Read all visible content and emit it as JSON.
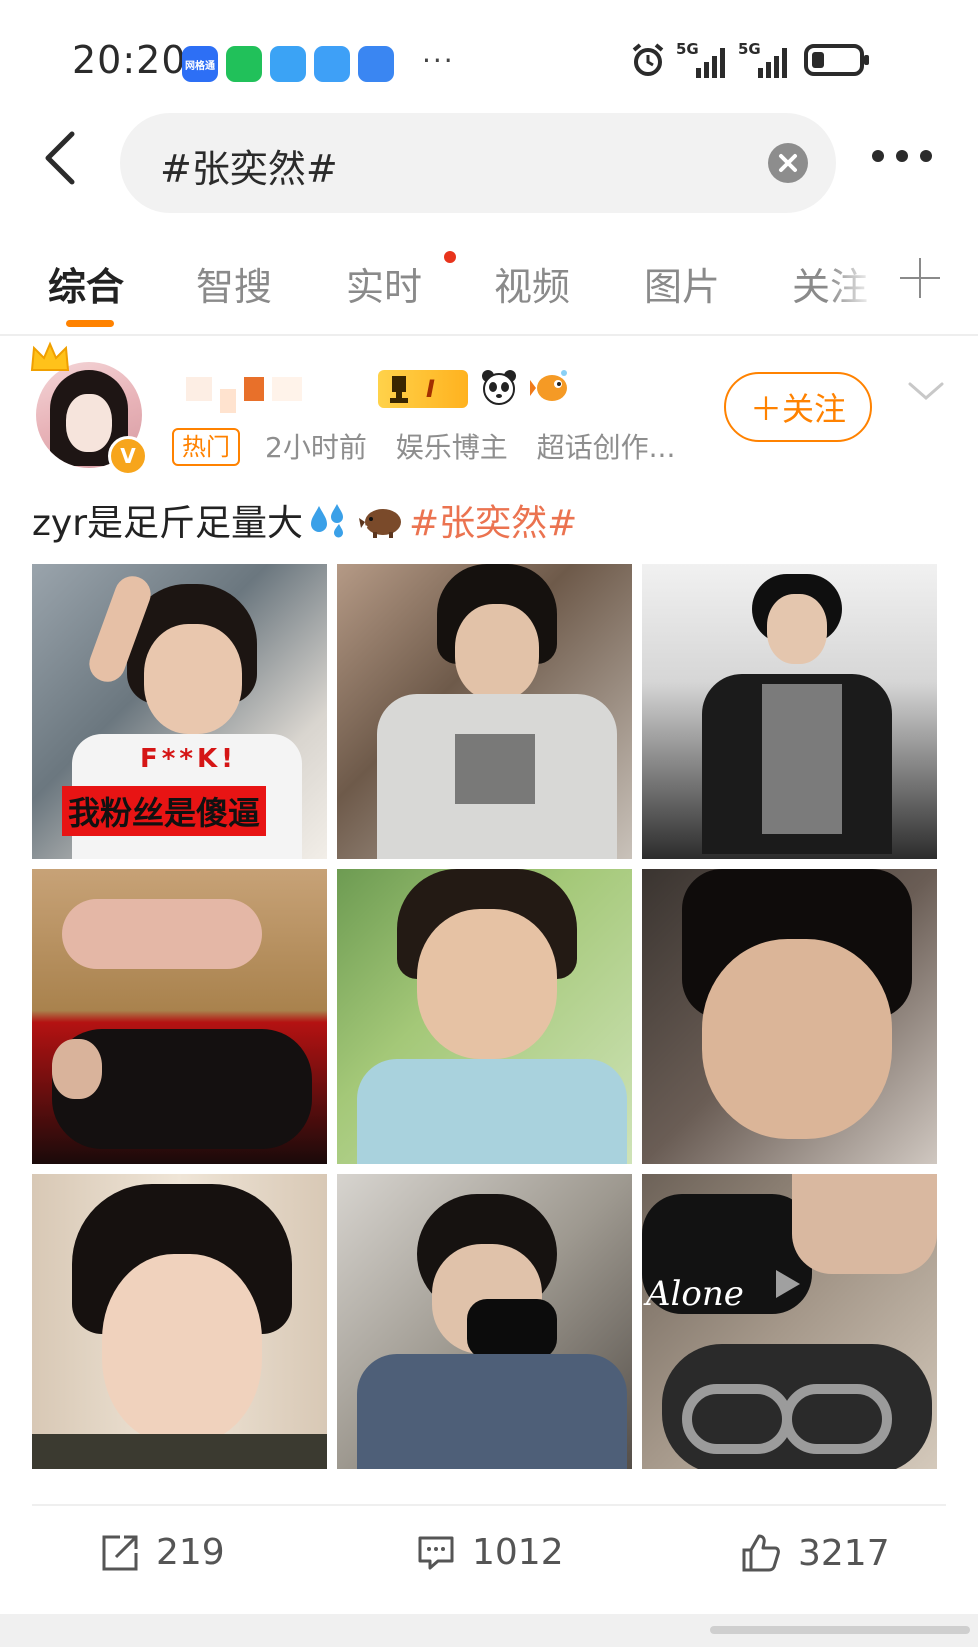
{
  "status_bar": {
    "time": "20:20",
    "more": "···",
    "notifications": [
      {
        "name": "wangxintong-app-icon",
        "label": "网格通",
        "color": "#2d6ff5"
      },
      {
        "name": "wechat-app-icon",
        "label": "",
        "color": "#21c15a"
      },
      {
        "name": "books-app-icon",
        "label": "",
        "color": "#3ba3f5"
      },
      {
        "name": "weather-app-icon",
        "label": "",
        "color": "#3ea0f7"
      },
      {
        "name": "message-app-icon",
        "label": "",
        "color": "#3a86f2"
      }
    ],
    "net1": "5G",
    "net2": "5G"
  },
  "search": {
    "query": "#张奕然#"
  },
  "tabs": [
    {
      "label": "综合",
      "active": true
    },
    {
      "label": "智搜",
      "active": false
    },
    {
      "label": "实时",
      "active": false,
      "dot": true
    },
    {
      "label": "视频",
      "active": false
    },
    {
      "label": "图片",
      "active": false
    },
    {
      "label": "关注",
      "active": false
    }
  ],
  "post": {
    "hot_tag": "热门",
    "time_ago": "2小时前",
    "role": "娱乐博主",
    "role2": "超话创作...",
    "level_badge": "I",
    "verified": "V",
    "follow_label": "＋关注",
    "text_prefix": "zyr是足斤足量大",
    "topic": "#张奕然#",
    "photos": [
      {
        "caption": "我粉丝是傻逼",
        "overlay": "F**K!"
      },
      {
        "caption": "",
        "overlay": ""
      },
      {
        "caption": "",
        "overlay": ""
      },
      {
        "caption": "",
        "overlay": ""
      },
      {
        "caption": "",
        "overlay": ""
      },
      {
        "caption": "",
        "overlay": ""
      },
      {
        "caption": "",
        "overlay": ""
      },
      {
        "caption": "",
        "overlay": ""
      },
      {
        "caption": "",
        "overlay": "Alone"
      }
    ]
  },
  "actions": {
    "repost": "219",
    "comment": "1012",
    "like": "3217"
  },
  "colors": {
    "accent": "#ff8200",
    "topic": "#eb7350",
    "red_dot": "#e8341c"
  }
}
